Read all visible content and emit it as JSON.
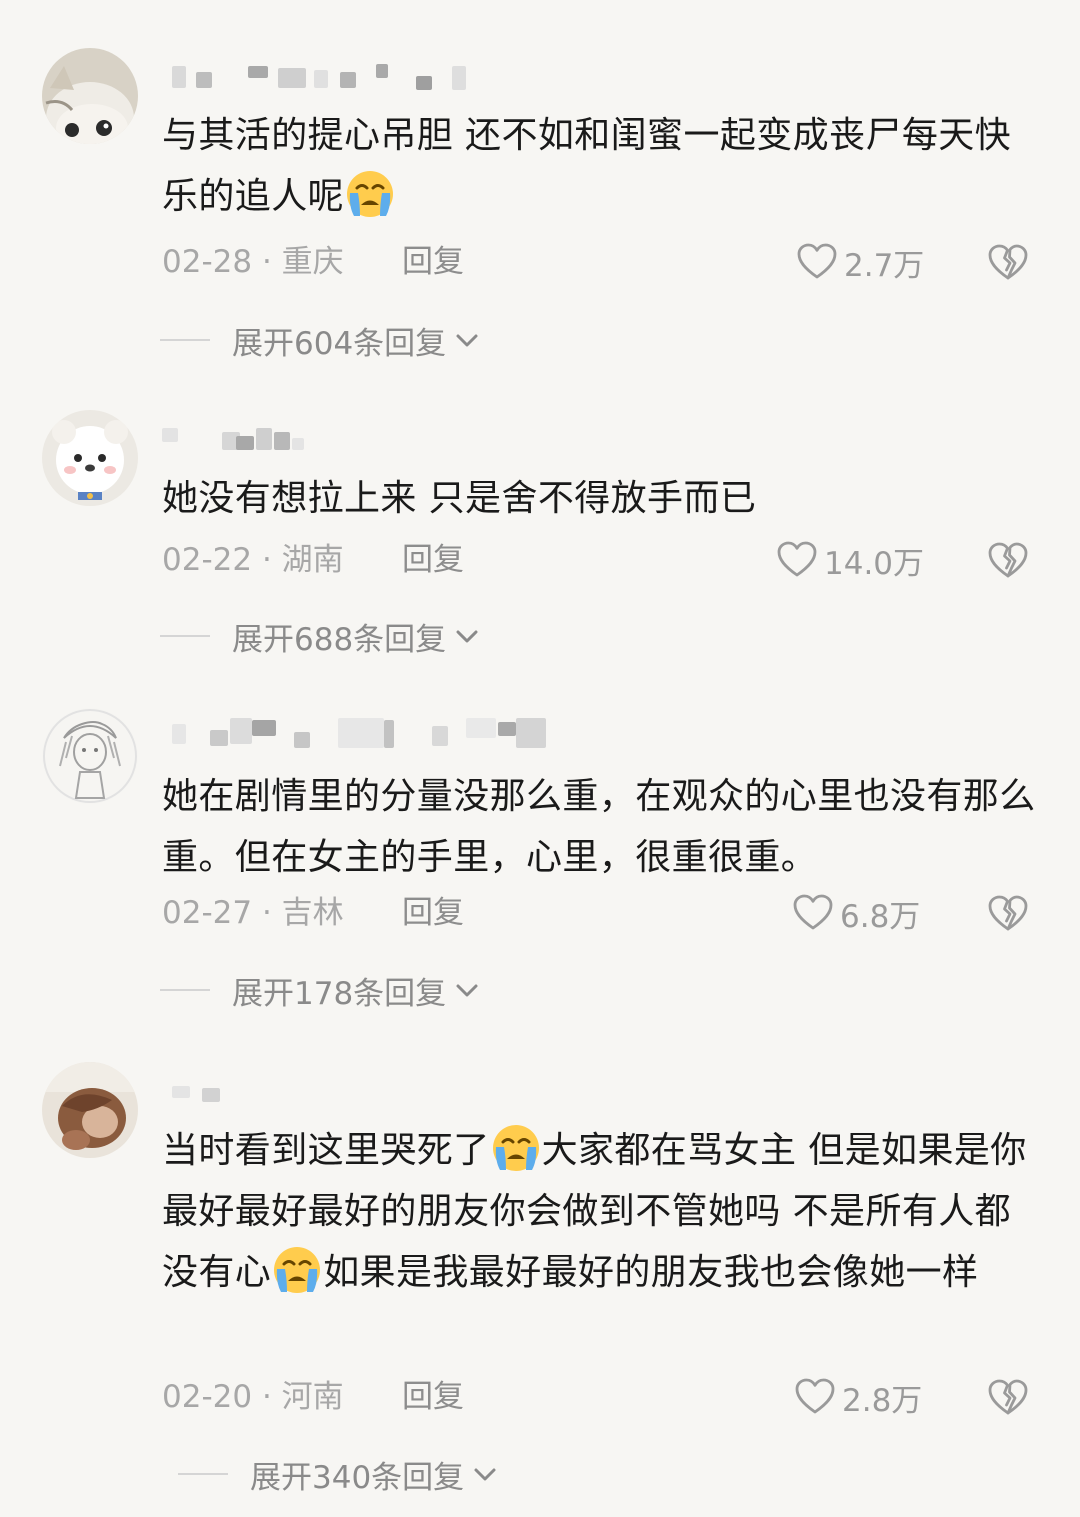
{
  "comments": [
    {
      "text_parts": [
        "与其活的提心吊胆 还不如和闺蜜一起变成丧尸每天快乐的追人呢",
        ""
      ],
      "date": "02-28",
      "location": "重庆",
      "reply_label": "回复",
      "likes": "2.7万",
      "expand_label": "展开604条回复"
    },
    {
      "text_parts": [
        "她没有想拉上来 只是舍不得放手而已"
      ],
      "date": "02-22",
      "location": "湖南",
      "reply_label": "回复",
      "likes": "14.0万",
      "expand_label": "展开688条回复"
    },
    {
      "text_parts": [
        "她在剧情里的分量没那么重，在观众的心里也没有那么重。但在女主的手里，心里，很重很重。"
      ],
      "date": "02-27",
      "location": "吉林",
      "reply_label": "回复",
      "likes": "6.8万",
      "expand_label": "展开178条回复"
    },
    {
      "text_parts": [
        "当时看到这里哭死了",
        "大家都在骂女主 但是如果是你最好最好最好的朋友你会做到不管她吗 不是所有人都没有心",
        "如果是我最好最好的朋友我也会像她一样"
      ],
      "date": "02-20",
      "location": "河南",
      "reply_label": "回复",
      "likes": "2.8万",
      "expand_label": "展开340条回复"
    }
  ],
  "separator": " · ",
  "icons": {
    "emoji": "loudly-crying-face-icon",
    "like": "heart-outline-icon",
    "dislike": "broken-heart-icon",
    "expand": "chevron-down-icon"
  },
  "colors": {
    "background": "#f7f6f3",
    "text": "#1a1a1a",
    "meta": "#a7a7a7",
    "emoji_face": "#ffcc4d",
    "emoji_tears": "#5dadec"
  }
}
